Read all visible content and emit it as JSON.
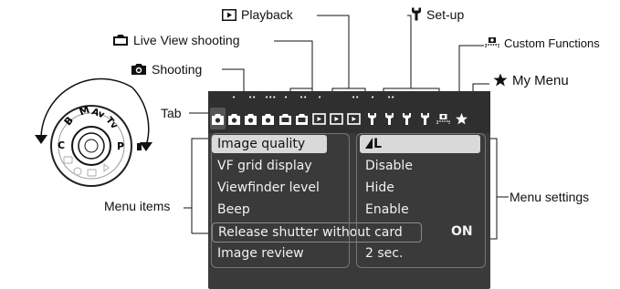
{
  "callouts": {
    "playback": "Playback",
    "setup": "Set-up",
    "live_view": "Live View shooting",
    "custom_functions": "Custom Functions",
    "shooting": "Shooting",
    "my_menu": "My Menu",
    "tab": "Tab",
    "menu_items": "Menu items",
    "menu_settings": "Menu settings"
  },
  "dial": {
    "modes": [
      "C",
      "B",
      "M",
      "Av",
      "Tv",
      "P"
    ]
  },
  "menu": {
    "rows": [
      {
        "name": "Image quality",
        "value": "L"
      },
      {
        "name": "VF grid display",
        "value": "Disable"
      },
      {
        "name": "Viewfinder level",
        "value": "Hide"
      },
      {
        "name": "Beep",
        "value": "Enable"
      },
      {
        "name": "Release shutter without card",
        "value": "ON"
      },
      {
        "name": "Image review",
        "value": "2 sec."
      }
    ]
  },
  "tabs": {
    "dots": [
      "•",
      "••",
      "•••",
      "•",
      "••",
      "•",
      "••",
      "•",
      "••",
      "•",
      "••",
      "•••",
      "•••"
    ]
  },
  "colors": {
    "screen": "#3a3a3a",
    "selected": "#d9d9d9",
    "text": "#f2f2f2"
  }
}
